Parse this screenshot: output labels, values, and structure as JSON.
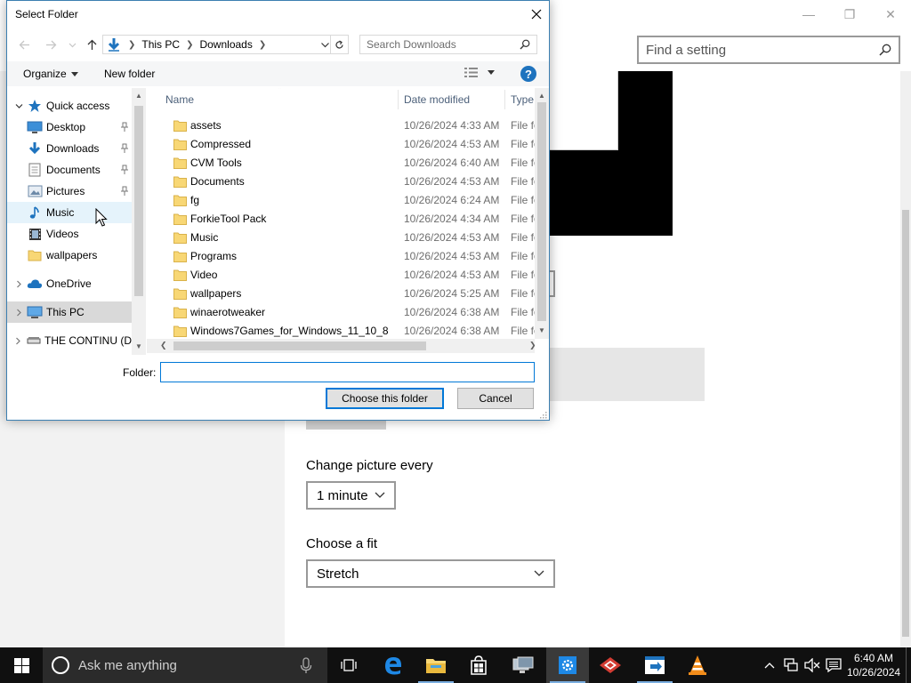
{
  "settings": {
    "search_placeholder": "Find a setting",
    "change_picture_label": "Change picture every",
    "change_picture_value": "1 minute",
    "fit_label": "Choose a fit",
    "fit_value": "Stretch"
  },
  "dialog": {
    "title": "Select Folder",
    "breadcrumb": [
      "This PC",
      "Downloads"
    ],
    "search_placeholder": "Search Downloads",
    "toolbar": {
      "organize": "Organize",
      "new_folder": "New folder"
    },
    "nav_items": [
      {
        "label": "Quick access",
        "icon": "star-icon",
        "pinned": false
      },
      {
        "label": "Desktop",
        "icon": "desktop-icon",
        "pinned": true
      },
      {
        "label": "Downloads",
        "icon": "downloads-icon",
        "pinned": true
      },
      {
        "label": "Documents",
        "icon": "documents-icon",
        "pinned": true
      },
      {
        "label": "Pictures",
        "icon": "pictures-icon",
        "pinned": true
      },
      {
        "label": "Music",
        "icon": "music-icon",
        "pinned": false
      },
      {
        "label": "Videos",
        "icon": "videos-icon",
        "pinned": false
      },
      {
        "label": "wallpapers",
        "icon": "folder-icon",
        "pinned": false
      },
      {
        "label": "OneDrive",
        "icon": "onedrive-icon",
        "pinned": false
      },
      {
        "label": "This PC",
        "icon": "this-pc-icon",
        "pinned": false
      },
      {
        "label": "THE CONTINU (D",
        "icon": "drive-icon",
        "pinned": false
      }
    ],
    "columns": {
      "name": "Name",
      "date": "Date modified",
      "type": "Type"
    },
    "files": [
      {
        "name": "assets",
        "date": "10/26/2024 4:33 AM",
        "type": "File fol"
      },
      {
        "name": "Compressed",
        "date": "10/26/2024 4:53 AM",
        "type": "File fol"
      },
      {
        "name": "CVM Tools",
        "date": "10/26/2024 6:40 AM",
        "type": "File fol"
      },
      {
        "name": "Documents",
        "date": "10/26/2024 4:53 AM",
        "type": "File fol"
      },
      {
        "name": "fg",
        "date": "10/26/2024 6:24 AM",
        "type": "File fol"
      },
      {
        "name": "ForkieTool Pack",
        "date": "10/26/2024 4:34 AM",
        "type": "File fol"
      },
      {
        "name": "Music",
        "date": "10/26/2024 4:53 AM",
        "type": "File fol"
      },
      {
        "name": "Programs",
        "date": "10/26/2024 4:53 AM",
        "type": "File fol"
      },
      {
        "name": "Video",
        "date": "10/26/2024 4:53 AM",
        "type": "File fol"
      },
      {
        "name": "wallpapers",
        "date": "10/26/2024 5:25 AM",
        "type": "File fol"
      },
      {
        "name": "winaerotweaker",
        "date": "10/26/2024 6:38 AM",
        "type": "File fol"
      },
      {
        "name": "Windows7Games_for_Windows_11_10_8",
        "date": "10/26/2024 6:38 AM",
        "type": "File fol"
      }
    ],
    "folder_label": "Folder:",
    "folder_value": "",
    "choose_button": "Choose this folder",
    "cancel_button": "Cancel"
  },
  "taskbar": {
    "search_placeholder": "Ask me anything",
    "apps": [
      "task-view-icon",
      "edge-icon",
      "file-explorer-icon",
      "store-icon",
      "remote-desktop-icon",
      "settings-icon",
      "toolbox-icon",
      "app-icon",
      "vlc-icon"
    ],
    "clock_time": "6:40 AM",
    "clock_date": "10/26/2024"
  },
  "colors": {
    "accent": "#0078d7",
    "folder": "#f8d775",
    "taskbar": "#101010"
  }
}
